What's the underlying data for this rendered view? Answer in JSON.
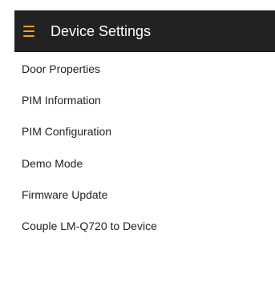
{
  "app_bar": {
    "menu_icon": "hamburger-menu-icon",
    "title": "Device Settings",
    "accent_color": "#f5a21c",
    "background_color": "#222222"
  },
  "menu": {
    "items": [
      {
        "label": "Door Properties"
      },
      {
        "label": "PIM Information"
      },
      {
        "label": "PIM Configuration"
      },
      {
        "label": "Demo Mode"
      },
      {
        "label": "Firmware Update"
      },
      {
        "label": "Couple LM-Q720 to Device"
      }
    ]
  }
}
